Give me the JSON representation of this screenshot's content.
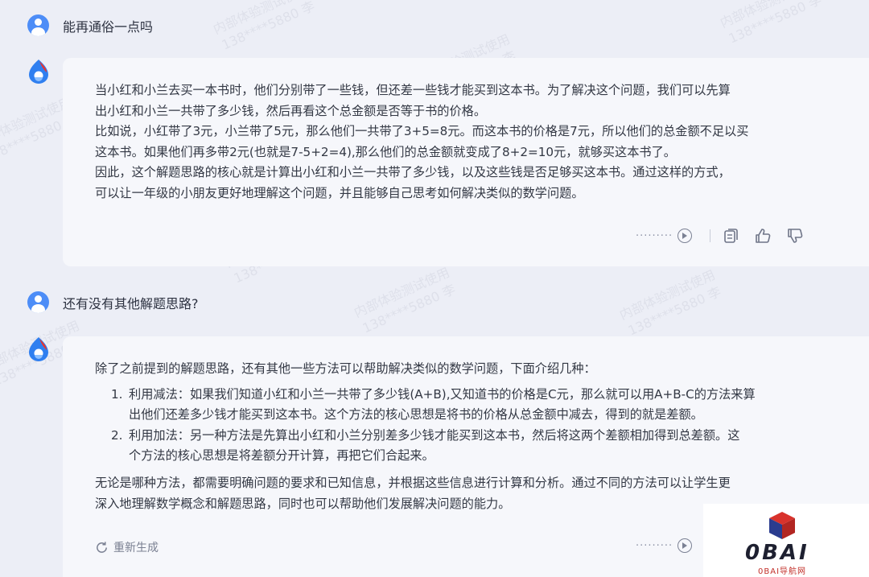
{
  "conversation": {
    "q1": "能再通俗一点吗",
    "a1": [
      "当小红和小兰去买一本书时，他们分别带了一些钱，但还差一些钱才能买到这本书。为了解决这个问题，我们可以先算",
      "出小红和小兰一共带了多少钱，然后再看这个总金额是否等于书的价格。",
      "比如说，小红带了3元，小兰带了5元，那么他们一共带了3+5=8元。而这本书的价格是7元，所以他们的总金额不足以买",
      "这本书。如果他们再多带2元(也就是7-5+2=4),那么他们的总金额就变成了8+2=10元，就够买这本书了。",
      "因此，这个解题思路的核心就是计算出小红和小兰一共带了多少钱，以及这些钱是否足够买这本书。通过这样的方式，",
      "可以让一年级的小朋友更好地理解这个问题，并且能够自己思考如何解决类似的数学问题。"
    ],
    "q2": "还有没有其他解题思路?",
    "a2": {
      "intro": "除了之前提到的解题思路，还有其他一些方法可以帮助解决类似的数学问题，下面介绍几种：",
      "steps": [
        {
          "num": "1.",
          "lines": [
            "利用减法：如果我们知道小红和小兰一共带了多少钱(A+B),又知道书的价格是C元，那么就可以用A+B-C的方法来算",
            "出他们还差多少钱才能买到这本书。这个方法的核心思想是将书的价格从总金额中减去，得到的就是差额。"
          ]
        },
        {
          "num": "2.",
          "lines": [
            "利用加法：另一种方法是先算出小红和小兰分别差多少钱才能买到这本书，然后将这两个差额相加得到总差额。这",
            "个方法的核心思想是将差额分开计算，再把它们合起来。"
          ]
        }
      ],
      "outro": [
        "无论是哪种方法，都需要明确问题的要求和已知信息，并根据这些信息进行计算和分析。通过不同的方法可以让学生更",
        "深入地理解数学概念和解题思路，同时也可以帮助他们发展解决问题的能力。"
      ]
    },
    "regenerate_label": "重新生成",
    "dots": "·········"
  },
  "watermark": {
    "line1": "内部体验测试使用",
    "line2": "138****5880 李"
  },
  "logo": {
    "text": "0BAI",
    "sub": "0BAI导航网"
  },
  "icons": {
    "user": "user-avatar-icon",
    "bot": "flame-logo-icon",
    "play": "play-circle-icon",
    "copy": "copy-icon",
    "like": "thumbs-up-icon",
    "dislike": "thumbs-down-icon",
    "regen": "refresh-icon"
  },
  "colors": {
    "background": "#eceef6",
    "card": "#f6f7fb",
    "user_avatar": "#4d8df7",
    "logo_red": "#c2302a"
  }
}
